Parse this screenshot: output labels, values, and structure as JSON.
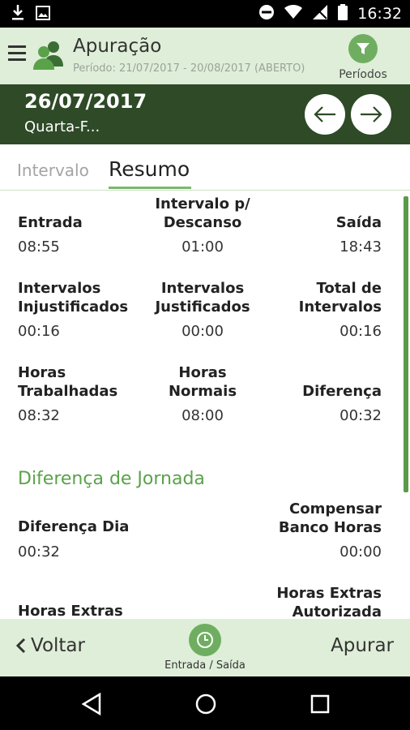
{
  "status_bar": {
    "time": "16:32"
  },
  "app_bar": {
    "title": "Apuração",
    "subtitle": "Período: 21/07/2017 - 20/08/2017 (ABERTO)",
    "periods_label": "Períodos"
  },
  "date_header": {
    "date": "26/07/2017",
    "weekday": "Quarta-F..."
  },
  "tabs": {
    "intervalo": "Intervalo",
    "resumo": "Resumo"
  },
  "summary": {
    "entrada": {
      "label": "Entrada",
      "value": "08:55"
    },
    "intervalo_descanso": {
      "label_line1": "Intervalo p/",
      "label_line2": "Descanso",
      "value": "01:00"
    },
    "saida": {
      "label": "Saída",
      "value": "18:43"
    },
    "intervalos_injustificados": {
      "label_line1": "Intervalos",
      "label_line2": "Injustificados",
      "value": "00:16"
    },
    "intervalos_justificados": {
      "label_line1": "Intervalos",
      "label_line2": "Justificados",
      "value": "00:00"
    },
    "total_intervalos": {
      "label_line1": "Total de",
      "label_line2": "Intervalos",
      "value": "00:16"
    },
    "horas_trabalhadas": {
      "label_line1": "Horas",
      "label_line2": "Trabalhadas",
      "value": "08:32"
    },
    "horas_normais": {
      "label_line1": "Horas",
      "label_line2": "Normais",
      "value": "08:00"
    },
    "diferenca": {
      "label": "Diferença",
      "value": "00:32"
    }
  },
  "jornada": {
    "section_title": "Diferença de Jornada",
    "diferenca_dia": {
      "label": "Diferença Dia",
      "value": "00:32"
    },
    "compensar_banco": {
      "label_line1": "Compensar",
      "label_line2": "Banco Horas",
      "value": "00:00"
    },
    "horas_extras": {
      "label": "Horas Extras"
    },
    "horas_extras_autorizada": {
      "label_line1": "Horas Extras",
      "label_line2": "Autorizada"
    }
  },
  "footer": {
    "back_label": "Voltar",
    "clock_label": "Entrada / Saída",
    "apurar_label": "Apurar"
  }
}
